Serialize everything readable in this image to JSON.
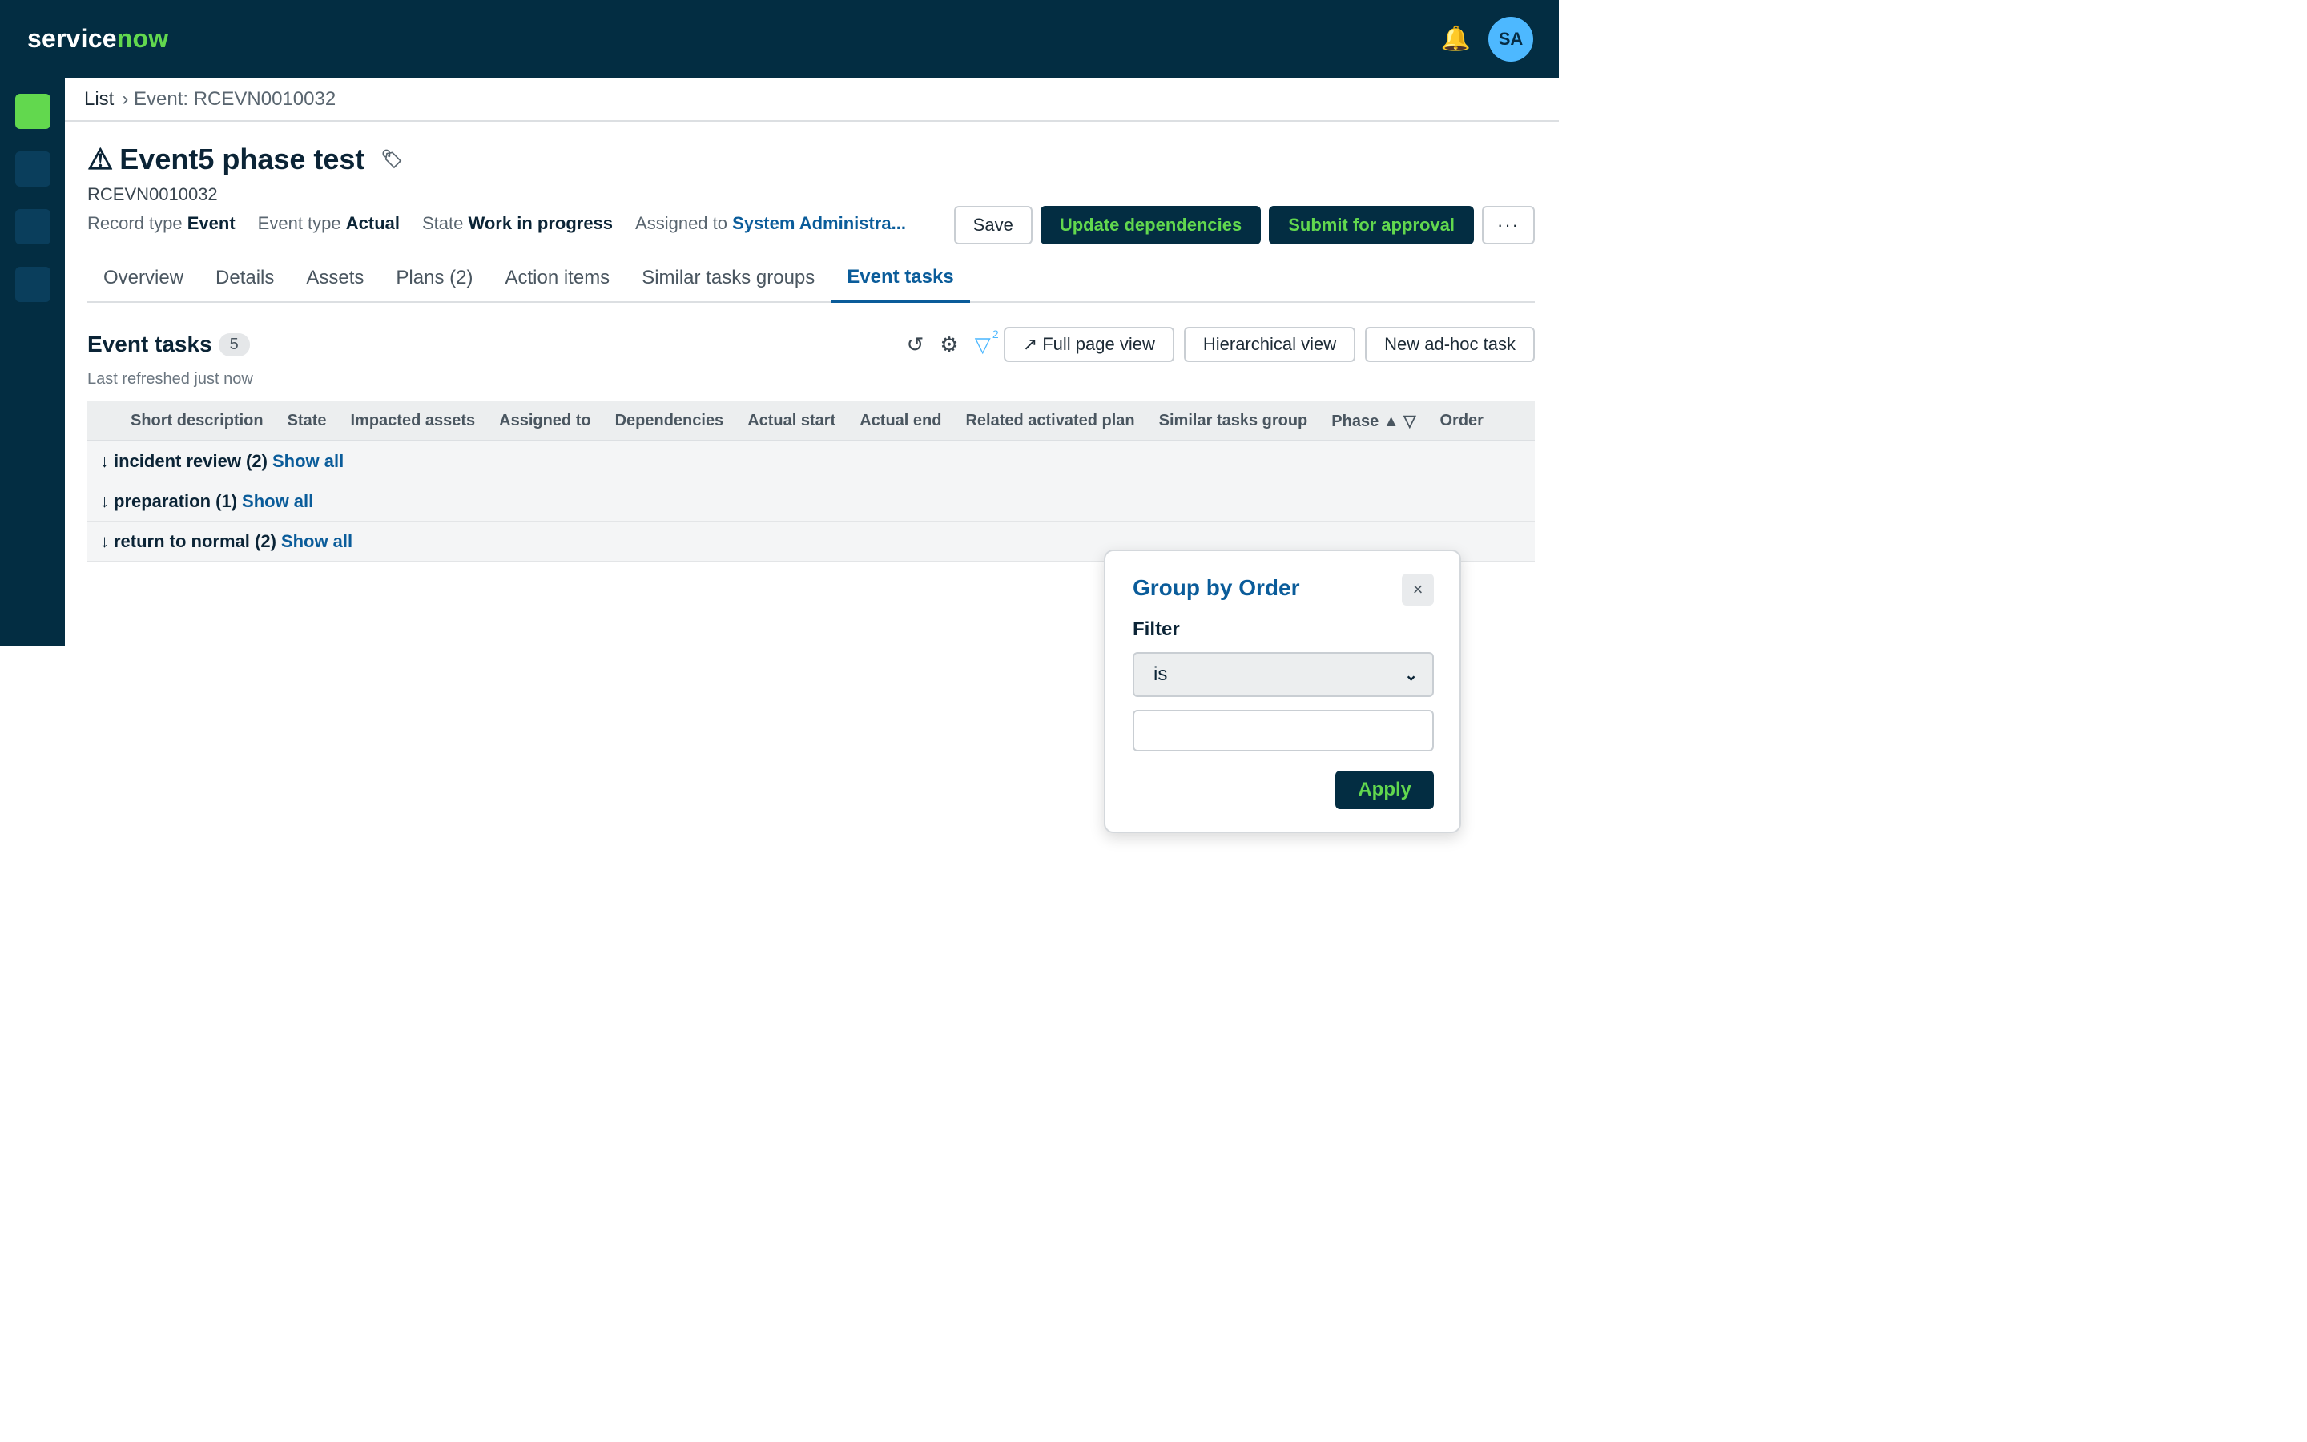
{
  "header": {
    "brand_service": "service",
    "brand_now": "now",
    "avatar_initials": "SA"
  },
  "rail": {
    "items": [
      "home",
      "app-1",
      "app-2",
      "app-3"
    ]
  },
  "breadcrumb": {
    "list": "List",
    "current": "› Event: RCEVN0010032"
  },
  "record": {
    "title": "Event5 phase test",
    "number": "RCEVN0010032",
    "meta": {
      "record_type_label": "Record type",
      "record_type": "Event",
      "event_type_label": "Event type",
      "event_type": "Actual",
      "state_label": "State",
      "state": "Work in progress",
      "assigned_label": "Assigned to",
      "assigned": "System Administra..."
    }
  },
  "actions": {
    "save": "Save",
    "update_dependencies": "Update dependencies",
    "submit": "Submit for approval",
    "more": "···"
  },
  "tabs": [
    "Overview",
    "Details",
    "Assets",
    "Plans (2)",
    "Action items",
    "Similar tasks groups",
    "Event tasks"
  ],
  "active_tab": "Event tasks",
  "list": {
    "title": "Event tasks",
    "count": "5",
    "refreshed": "Last refreshed just now",
    "filter_count": "2",
    "full_page": "↗ Full page view",
    "hierarchical": "Hierarchical view",
    "new_task": "New ad-hoc task",
    "columns": [
      "Short description",
      "State",
      "Impacted assets",
      "Assigned to",
      "Dependencies",
      "Actual start",
      "Actual end",
      "Related activated plan",
      "Similar tasks group",
      "Phase ▲ ▽",
      "Order"
    ],
    "groups": [
      {
        "label": "incident review (2)",
        "show_all": "Show all"
      },
      {
        "label": "preparation (1)",
        "show_all": "Show all"
      },
      {
        "label": "return to normal (2)",
        "show_all": "Show all"
      }
    ]
  },
  "popover": {
    "title": "Group by Order",
    "close": "×",
    "filter_label": "Filter",
    "operator": "is",
    "value": "",
    "apply": "Apply"
  },
  "colors": {
    "brand_dark": "#032d42",
    "brand_green": "#62d84e",
    "link_blue": "#0a5c9a",
    "avatar_blue": "#4db8ff"
  },
  "icons": [
    "bell-icon",
    "warning-icon",
    "tag-icon",
    "refresh-icon",
    "gear-icon",
    "filter-icon",
    "chevron-down-icon",
    "close-icon"
  ]
}
